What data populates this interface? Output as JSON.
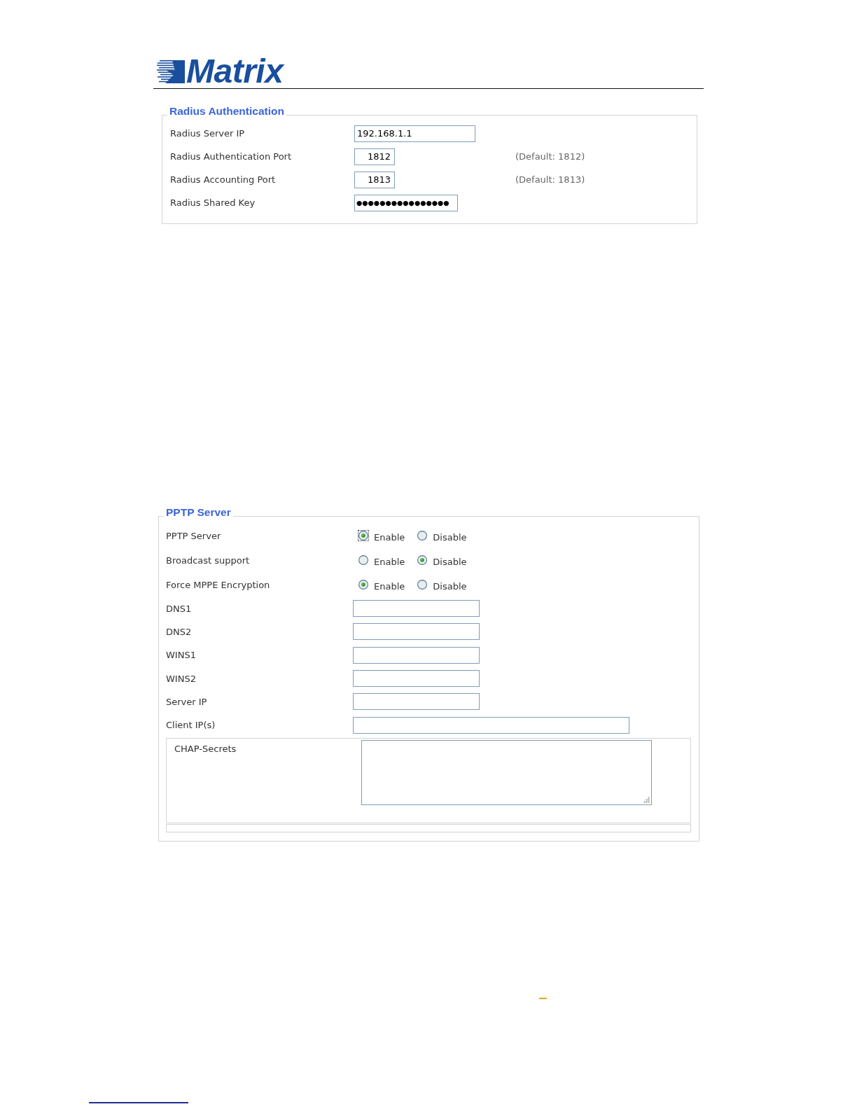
{
  "header": {
    "logo_text": "Matrix"
  },
  "radius_authentication": {
    "legend": "Radius Authentication",
    "rows": [
      {
        "label": "Radius Server IP",
        "kind": "ip",
        "value": "192.168.1.1"
      },
      {
        "label": "Radius Authentication Port",
        "kind": "port",
        "value": "1812",
        "hint": "(Default: 1812)"
      },
      {
        "label": "Radius Accounting Port",
        "kind": "port",
        "value": "1813",
        "hint": "(Default: 1813)"
      },
      {
        "label": "Radius Shared Key",
        "kind": "password",
        "value": "●●●●●●●●●●●●●●●●"
      }
    ]
  },
  "pptp_server": {
    "legend": "PPTP Server",
    "rows": [
      {
        "label": "PPTP Server",
        "kind": "radio",
        "options": [
          {
            "label": "Enable",
            "selected": true,
            "focused": true
          },
          {
            "label": "Disable",
            "selected": false,
            "focused": false
          }
        ]
      },
      {
        "label": "Broadcast support",
        "kind": "radio",
        "options": [
          {
            "label": "Enable",
            "selected": false,
            "focused": false
          },
          {
            "label": "Disable",
            "selected": true,
            "focused": false
          }
        ]
      },
      {
        "label": "Force MPPE Encryption",
        "kind": "radio",
        "options": [
          {
            "label": "Enable",
            "selected": true,
            "focused": false
          },
          {
            "label": "Disable",
            "selected": false,
            "focused": false
          }
        ]
      },
      {
        "label": "DNS1",
        "kind": "text"
      },
      {
        "label": "DNS2",
        "kind": "text"
      },
      {
        "label": "WINS1",
        "kind": "text"
      },
      {
        "label": "WINS2",
        "kind": "text"
      },
      {
        "label": "Server IP",
        "kind": "text"
      },
      {
        "label": "Client IP(s)",
        "kind": "text_long"
      }
    ],
    "chap_secrets": {
      "label": "CHAP-Secrets"
    }
  }
}
